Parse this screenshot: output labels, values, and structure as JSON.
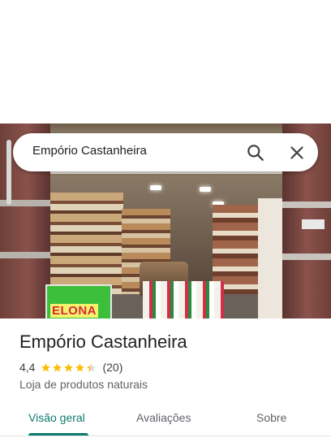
{
  "search": {
    "query": "Empório Castanheira"
  },
  "photo": {
    "sign_text": "ELONA"
  },
  "place": {
    "name": "Empório Castanheira",
    "rating": "4,4",
    "rating_value": 4.4,
    "review_count": "(20)",
    "category": "Loja de produtos naturais"
  },
  "tabs": [
    {
      "label": "Visão geral",
      "active": true
    },
    {
      "label": "Avaliações",
      "active": false
    },
    {
      "label": "Sobre",
      "active": false
    }
  ],
  "icons": {
    "search": "search-icon",
    "close": "close-icon",
    "star": "star-icon"
  },
  "colors": {
    "accent": "#0b7a6f",
    "star": "#fbbc04",
    "star_empty": "#dadce0"
  }
}
